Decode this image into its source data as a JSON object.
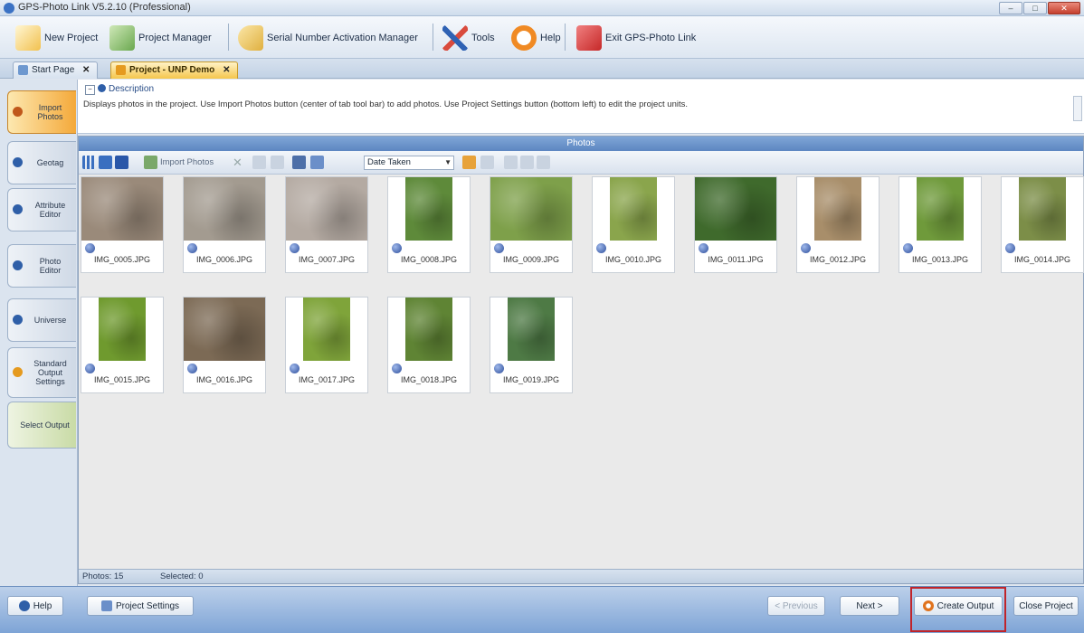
{
  "window": {
    "title": "GPS-Photo Link V5.2.10 (Professional)",
    "controls": [
      "minimize",
      "maximize",
      "close"
    ]
  },
  "toolbar": {
    "items": [
      {
        "label": "New Project",
        "icon": "new-project-icon",
        "color": "#f2c14e"
      },
      {
        "label": "Project Manager",
        "icon": "project-manager-icon",
        "color": "#6aa84f"
      },
      {
        "label": "Serial Number Activation Manager",
        "icon": "key-icon",
        "color": "#e0b040"
      },
      {
        "label": "Tools",
        "icon": "tools-icon",
        "color": "#d94b3d"
      },
      {
        "label": "Help",
        "icon": "help-ring-icon",
        "color": "#f08a24"
      },
      {
        "label": "Exit GPS-Photo Link",
        "icon": "exit-icon",
        "color": "#c62828"
      }
    ]
  },
  "tabs": [
    {
      "label": "Start Page",
      "close": "✕",
      "active": false
    },
    {
      "label": "Project - UNP Demo",
      "close": "✕",
      "active": true
    }
  ],
  "sidebar": {
    "items": [
      {
        "label": "Import Photos",
        "active": true
      },
      {
        "label": "Geotag",
        "active": false
      },
      {
        "label": "Attribute Editor",
        "active": false
      },
      {
        "label": "Photo Editor",
        "active": false
      },
      {
        "label": "Universe",
        "active": false
      },
      {
        "label": "Standard Output Settings",
        "active": false
      },
      {
        "label": "Select Output",
        "active": false
      }
    ]
  },
  "description": {
    "header": "Description",
    "text": "Displays photos in the project. Use Import Photos button (center of tab tool bar) to add photos. Use Project Settings button (bottom left) to edit the project units."
  },
  "photos": {
    "panel_title": "Photos",
    "toolbar": {
      "import_label": "Import Photos",
      "sort_value": "Date Taken"
    },
    "items": [
      {
        "name": "IMG_0005.JPG",
        "color": "#9a8a7a",
        "orientation": "landscape"
      },
      {
        "name": "IMG_0006.JPG",
        "color": "#a39b90",
        "orientation": "landscape"
      },
      {
        "name": "IMG_0007.JPG",
        "color": "#b4aaa2",
        "orientation": "landscape"
      },
      {
        "name": "IMG_0008.JPG",
        "color": "#5e8a3a",
        "orientation": "portrait"
      },
      {
        "name": "IMG_0009.JPG",
        "color": "#7ea04a",
        "orientation": "landscape"
      },
      {
        "name": "IMG_0010.JPG",
        "color": "#8aa54c",
        "orientation": "portrait"
      },
      {
        "name": "IMG_0011.JPG",
        "color": "#3f6a2c",
        "orientation": "landscape"
      },
      {
        "name": "IMG_0012.JPG",
        "color": "#a88e6a",
        "orientation": "portrait"
      },
      {
        "name": "IMG_0013.JPG",
        "color": "#6f9a3b",
        "orientation": "portrait"
      },
      {
        "name": "IMG_0014.JPG",
        "color": "#7c8e48",
        "orientation": "portrait"
      },
      {
        "name": "IMG_0015.JPG",
        "color": "#6f9a2e",
        "orientation": "portrait"
      },
      {
        "name": "IMG_0016.JPG",
        "color": "#7c6a55",
        "orientation": "landscape"
      },
      {
        "name": "IMG_0017.JPG",
        "color": "#7fa43a",
        "orientation": "portrait"
      },
      {
        "name": "IMG_0018.JPG",
        "color": "#5f8434",
        "orientation": "portrait"
      },
      {
        "name": "IMG_0019.JPG",
        "color": "#4e7a45",
        "orientation": "portrait"
      }
    ],
    "status": {
      "photos_label": "Photos: 15",
      "selected_label": "Selected: 0"
    }
  },
  "bottom": {
    "help_label": "Help",
    "project_settings_label": "Project Settings",
    "previous_label": "< Previous",
    "next_label": "Next >",
    "create_output_label": "Create Output",
    "close_project_label": "Close Project"
  },
  "colors": {
    "accent_orange": "#f4a93a",
    "header_blue": "#5d86c1",
    "highlight_red": "#c0242a"
  }
}
